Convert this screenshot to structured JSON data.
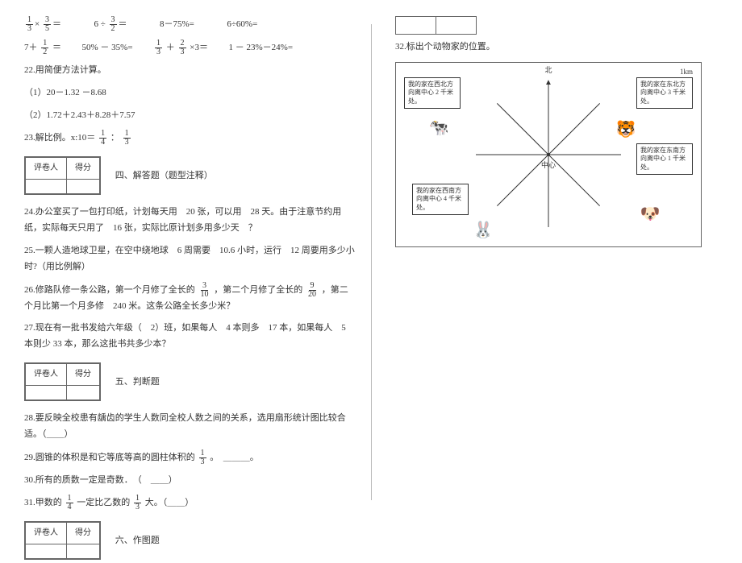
{
  "q_top": {
    "expr1_a": "1",
    "expr1_b": "3",
    "expr1_c": "3",
    "expr1_d": "5",
    "expr2": "6 ÷",
    "expr2_a": "3",
    "expr2_b": "2",
    "expr3": "8－75%=",
    "expr4": "6÷60%=",
    "expr5": "7＋",
    "expr5_a": "1",
    "expr5_b": "2",
    "expr5_eq": "＝",
    "expr6": "50% － 35%=",
    "expr7_a": "1",
    "expr7_b": "3",
    "expr7_c": "2",
    "expr7_d": "3",
    "expr7_mid": "＋",
    "expr7_tail": "×3＝",
    "expr8": "1 － 23%－24%="
  },
  "q22": {
    "title": "22.用简便方法计算。",
    "sub1": "（1）20－1.32 －8.68",
    "sub2": "（2）1.72＋2.43＋8.28＋7.57"
  },
  "q23": {
    "prefix": "23.解比例。x:10＝",
    "a": "1",
    "b": "4",
    "mid": "：",
    "c": "1",
    "d": "3"
  },
  "score_header1": "评卷人",
  "score_header2": "得分",
  "section4": "四、解答题（题型注释）",
  "q24": "24.办公室买了一包打印纸，计划每天用　20 张，可以用　28 天。由于注意节约用纸，实际每天只用了　16 张，实际比原计划多用多少天　？",
  "q25": "25.一颗人造地球卫星，在空中绕地球　6 周需要　10.6 小时，运行　12 周要用多少小时?（用比例解）",
  "q26": {
    "p1": "26.修路队修一条公路，第一个月修了全长的",
    "f1n": "3",
    "f1d": "10",
    "p2": "，第二个月修了全长的",
    "f2n": "9",
    "f2d": "20",
    "p3": "，第二个月比第一个月多修　240 米。这条公路全长多少米？"
  },
  "q27": "27.现在有一批书发给六年级（　2）班，如果每人　4 本则多　17 本，如果每人　5 本则少 33 本，那么这批书共多少本？",
  "section5": "五、判断题",
  "q28": "28.要反映全校患有龋齿的学生人数同全校人数之间的关系，选用扇形统计图比较合适。（＿＿）",
  "q29": {
    "p1": "29.圆锥的体积是和它等底等高的圆柱体积的",
    "fn": "1",
    "fd": "3",
    "p2": "。　＿＿＿。"
  },
  "q30": "30.所有的质数一定是奇数．　（　＿＿）",
  "q31": {
    "p1": "31.甲数的",
    "f1n": "1",
    "f1d": "4",
    "p2": "一定比乙数的",
    "f2n": "1",
    "f2d": "3",
    "p3": "大。（＿＿）"
  },
  "section6": "六、作图题",
  "q32": "32.标出个动物家的位置。",
  "diagram": {
    "north": "北",
    "scale": "1km",
    "center": "中心",
    "speech_nw": "我的家在西北方向离中心 2 千米处。",
    "speech_ne": "我的家在东北方向离中心 3 千米处。",
    "speech_sw": "我的家在西南方向离中心 4 千米处。",
    "speech_se": "我的家在东南方向离中心 1 千米处。"
  }
}
